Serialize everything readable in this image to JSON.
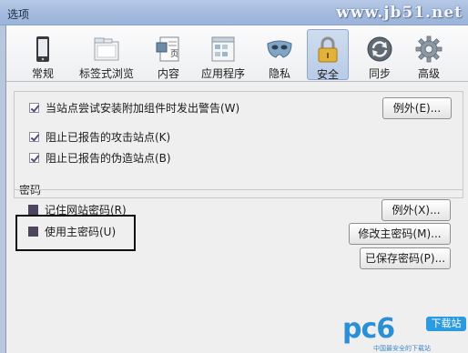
{
  "window": {
    "title": "选项"
  },
  "watermark": "www.jb51.net",
  "tabs": [
    {
      "label": "常规",
      "icon": "device-icon"
    },
    {
      "label": "标签式浏览",
      "icon": "folder-tabs-icon"
    },
    {
      "label": "内容",
      "icon": "document-icon"
    },
    {
      "label": "应用程序",
      "icon": "applications-icon"
    },
    {
      "label": "隐私",
      "icon": "mask-icon"
    },
    {
      "label": "安全",
      "icon": "padlock-icon",
      "active": true
    },
    {
      "label": "同步",
      "icon": "sync-icon"
    },
    {
      "label": "高级",
      "icon": "gear-icon"
    }
  ],
  "security": {
    "warn_addons": {
      "label": "当站点尝试安装附加组件时发出警告(W)",
      "checked": true
    },
    "exceptions_button_1": "例外(E)...",
    "block_attack": {
      "label": "阻止已报告的攻击站点(K)",
      "checked": true
    },
    "block_forgery": {
      "label": "阻止已报告的伪造站点(B)",
      "checked": true
    }
  },
  "passwords": {
    "section_title": "密码",
    "remember": {
      "label": "记住网站密码(R)",
      "checked": false
    },
    "master": {
      "label": "使用主密码(U)",
      "checked": false
    },
    "exceptions_button": "例外(X)...",
    "change_master_button": "修改主密码(M)...",
    "saved_passwords_button": "已保存密码(P)..."
  },
  "logo": {
    "brand": "pc6",
    "badge": "下载站",
    "tagline": "中国最安全的下载站"
  },
  "colors": {
    "titlebar": "#a3bbdf",
    "active_tab": "#c4d4ec",
    "checkbox_mark": "#5d4d7f",
    "highlight_border": "#101010",
    "logo_blue": "#2b8fd6"
  }
}
